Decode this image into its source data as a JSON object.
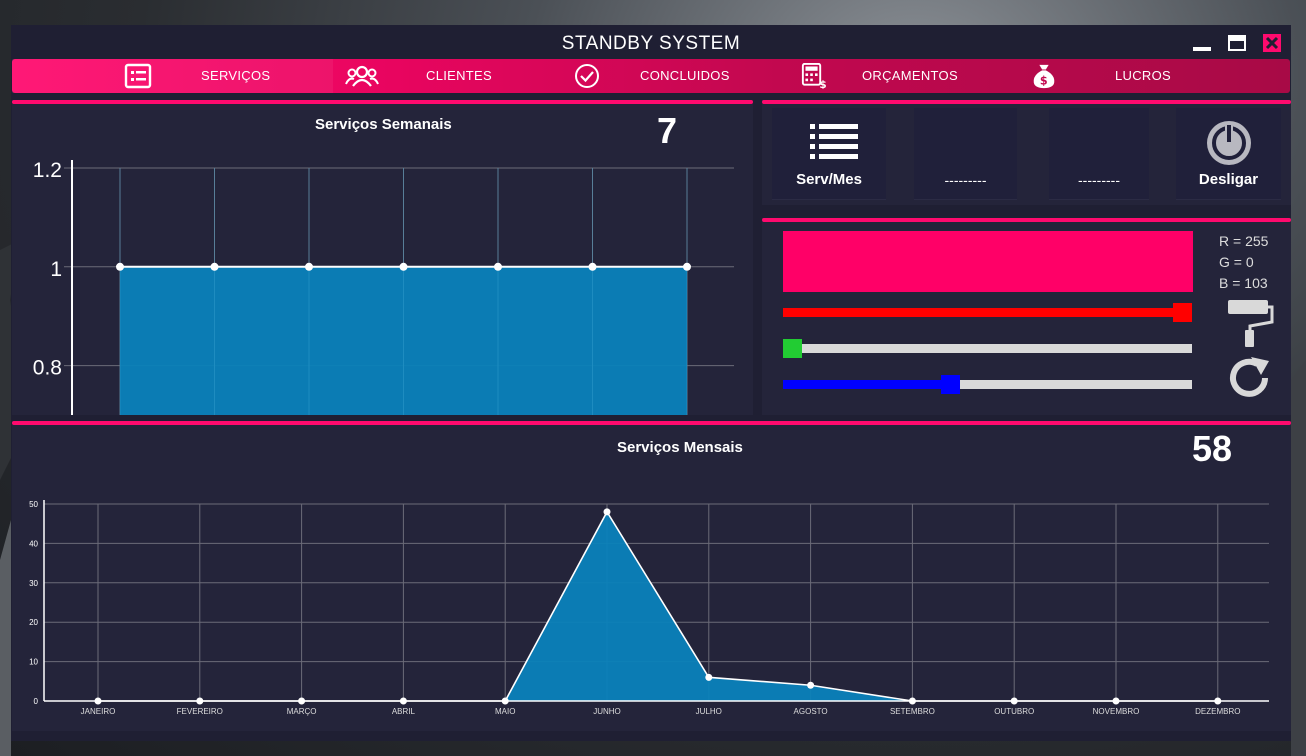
{
  "window": {
    "title": "STANDBY SYSTEM"
  },
  "nav": {
    "items": [
      {
        "label": "SERVIÇOS",
        "icon": "list-form-icon",
        "active": true
      },
      {
        "label": "CLIENTES",
        "icon": "users-icon",
        "active": false
      },
      {
        "label": "CONCLUIDOS",
        "icon": "check-circle-icon",
        "active": false
      },
      {
        "label": "ORÇAMENTOS",
        "icon": "calculator-dollar-icon",
        "active": false
      },
      {
        "label": "LUCROS",
        "icon": "money-bag-icon",
        "active": false
      }
    ]
  },
  "weekly": {
    "title": "Serviços Semanais",
    "count": "7"
  },
  "monthly": {
    "title": "Serviços Mensais",
    "count": "58"
  },
  "tiles": [
    {
      "label": "Serv/Mes",
      "icon": "list-icon"
    },
    {
      "label": "---------",
      "icon": ""
    },
    {
      "label": "---------",
      "icon": ""
    },
    {
      "label": "Desligar",
      "icon": "power-icon"
    }
  ],
  "color_picker": {
    "preview_color": "#ff0067",
    "r_text": "R = 255",
    "g_text": "G = 0",
    "b_text": "B = 103",
    "r_value": 255,
    "g_value": 0,
    "b_value": 103,
    "max": 255
  },
  "colors": {
    "accent": "#ff0a6e",
    "panel": "#24243a",
    "area_fill": "#0b82ba",
    "slider_red": "#ff0000",
    "slider_green": "#22cc33",
    "slider_blue": "#0000ff"
  },
  "chart_data": [
    {
      "type": "area",
      "title": "Serviços Semanais",
      "x": [
        1,
        2,
        3,
        4,
        5,
        6,
        7
      ],
      "values": [
        1,
        1,
        1,
        1,
        1,
        1,
        1
      ],
      "ylim": [
        0.7,
        1.2
      ],
      "yticks": [
        "1.2",
        "1",
        "0.8"
      ],
      "grid": true
    },
    {
      "type": "area",
      "title": "Serviços Mensais",
      "categories": [
        "JANEIRO",
        "FEVEREIRO",
        "MARÇO",
        "ABRIL",
        "MAIO",
        "JUNHO",
        "JULHO",
        "AGOSTO",
        "SETEMBRO",
        "OUTUBRO",
        "NOVEMBRO",
        "DEZEMBRO"
      ],
      "values": [
        0,
        0,
        0,
        0,
        0,
        48,
        6,
        4,
        0,
        0,
        0,
        0
      ],
      "ylim": [
        0,
        50
      ],
      "yticks": [
        "50",
        "40",
        "30",
        "20",
        "10",
        "0"
      ],
      "grid": true
    }
  ]
}
